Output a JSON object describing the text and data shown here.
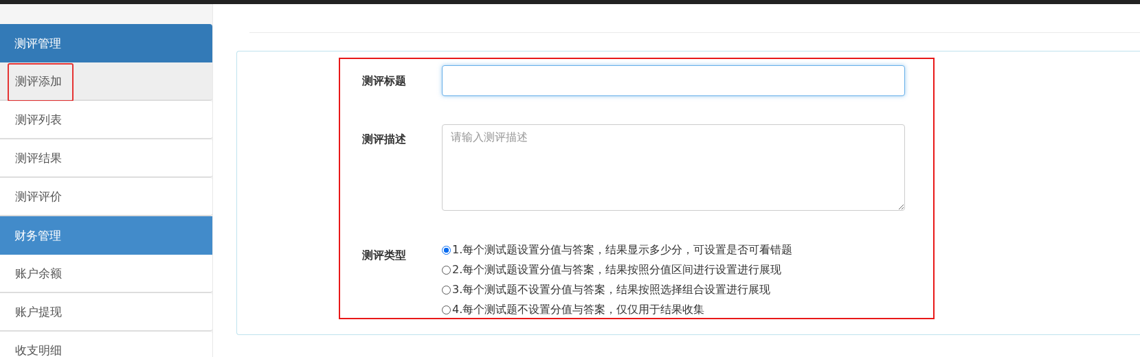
{
  "sidebar": {
    "groups": [
      {
        "header": "测评管理",
        "items": [
          {
            "label": "测评添加",
            "selected": true,
            "marked": true
          },
          {
            "label": "测评列表",
            "selected": false,
            "marked": false
          },
          {
            "label": "测评结果",
            "selected": false,
            "marked": false
          },
          {
            "label": "测评评价",
            "selected": false,
            "marked": false
          }
        ]
      },
      {
        "header": "财务管理",
        "items": [
          {
            "label": "账户余额",
            "selected": false,
            "marked": false
          },
          {
            "label": "账户提现",
            "selected": false,
            "marked": false
          },
          {
            "label": "收支明细",
            "selected": false,
            "marked": false
          }
        ]
      }
    ]
  },
  "form": {
    "marked": true,
    "title_field": {
      "label": "测评标题",
      "focused": true
    },
    "description_field": {
      "label": "测评描述",
      "placeholder": "请输入测评描述"
    },
    "type_field": {
      "label": "测评类型",
      "options": [
        {
          "label": "1.每个测试题设置分值与答案，结果显示多少分，可设置是否可看错题",
          "selected": true
        },
        {
          "label": "2.每个测试题设置分值与答案，结果按照分值区间进行设置进行展现",
          "selected": false
        },
        {
          "label": "3.每个测试题不设置分值与答案，结果按照选择组合设置进行展现",
          "selected": false
        },
        {
          "label": "4.每个测试题不设置分值与答案，仅仅用于结果收集",
          "selected": false
        }
      ]
    }
  }
}
